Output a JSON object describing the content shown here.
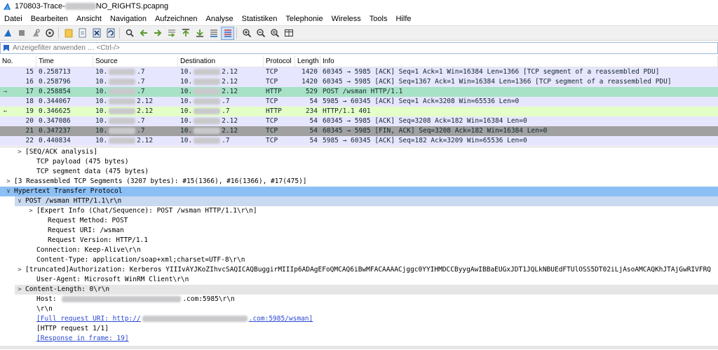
{
  "window": {
    "title_prefix": "170803-Trace-",
    "title_suffix": "NO_RIGHTS.pcapng",
    "icon": "wireshark-fin-icon"
  },
  "menu": [
    "Datei",
    "Bearbeiten",
    "Ansicht",
    "Navigation",
    "Aufzeichnen",
    "Analyse",
    "Statistiken",
    "Telephonie",
    "Wireless",
    "Tools",
    "Hilfe"
  ],
  "toolbar": {
    "buttons": [
      "start-capture-icon",
      "stop-capture-icon",
      "restart-capture-icon",
      "capture-options-icon",
      "open-file-icon",
      "save-file-icon",
      "close-file-icon",
      "reload-file-icon",
      "find-packet-icon",
      "go-back-icon",
      "go-forward-icon",
      "go-to-packet-icon",
      "go-first-icon",
      "go-last-icon",
      "autoscroll-icon",
      "colorize-icon",
      "zoom-in-icon",
      "zoom-out-icon",
      "zoom-normal-icon",
      "resize-columns-icon"
    ]
  },
  "filter": {
    "placeholder": "Anzeigefilter anwenden … <Ctrl-/>"
  },
  "packet_list": {
    "headers": [
      "No.",
      "Time",
      "Source",
      "Destination",
      "Protocol",
      "Length",
      "Info"
    ],
    "rows": [
      {
        "no": "15",
        "time": "0.258713",
        "src_a": "10.",
        "src_b": ".7",
        "dst_a": "10.",
        "dst_b": "2.12",
        "proto": "TCP",
        "len": "1420",
        "info": "60345 → 5985 [ACK] Seq=1 Ack=1 Win=16384 Len=1366 [TCP segment of a reassembled PDU]",
        "bg": "#e7e6ff",
        "fg": "#12272e",
        "gutter": ""
      },
      {
        "no": "16",
        "time": "0.258796",
        "src_a": "10.",
        "src_b": ".7",
        "dst_a": "10.",
        "dst_b": "2.12",
        "proto": "TCP",
        "len": "1420",
        "info": "60345 → 5985 [ACK] Seq=1367 Ack=1 Win=16384 Len=1366 [TCP segment of a reassembled PDU]",
        "bg": "#e7e6ff",
        "fg": "#12272e",
        "gutter": ""
      },
      {
        "no": "17",
        "time": "0.258854",
        "src_a": "10.",
        "src_b": ".7",
        "dst_a": "10.",
        "dst_b": "2.12",
        "proto": "HTTP",
        "len": "529",
        "info": "POST /wsman HTTP/1.1",
        "bg": "#a8e2c6",
        "fg": "#12272e",
        "gutter": "→"
      },
      {
        "no": "18",
        "time": "0.344067",
        "src_a": "10.",
        "src_b": "2.12",
        "dst_a": "10.",
        "dst_b": ".7",
        "proto": "TCP",
        "len": "54",
        "info": "5985 → 60345 [ACK] Seq=1 Ack=3208 Win=65536 Len=0",
        "bg": "#e7e6ff",
        "fg": "#12272e",
        "gutter": ""
      },
      {
        "no": "19",
        "time": "0.346625",
        "src_a": "10.",
        "src_b": "2.12",
        "dst_a": "10.",
        "dst_b": ".7",
        "proto": "HTTP",
        "len": "234",
        "info": "HTTP/1.1 401",
        "bg": "#e4ffc7",
        "fg": "#12272e",
        "gutter": "←"
      },
      {
        "no": "20",
        "time": "0.347086",
        "src_a": "10.",
        "src_b": ".7",
        "dst_a": "10.",
        "dst_b": "2.12",
        "proto": "TCP",
        "len": "54",
        "info": "60345 → 5985 [ACK] Seq=3208 Ack=182 Win=16384 Len=0",
        "bg": "#e7e6ff",
        "fg": "#12272e",
        "gutter": ""
      },
      {
        "no": "21",
        "time": "0.347237",
        "src_a": "10.",
        "src_b": ".7",
        "dst_a": "10.",
        "dst_b": "2.12",
        "proto": "TCP",
        "len": "54",
        "info": "60345 → 5985 [FIN, ACK] Seq=3208 Ack=182 Win=16384 Len=0",
        "bg": "#a0a0a0",
        "fg": "#12272e",
        "gutter": ""
      },
      {
        "no": "22",
        "time": "0.440834",
        "src_a": "10.",
        "src_b": "2.12",
        "dst_a": "10.",
        "dst_b": ".7",
        "proto": "TCP",
        "len": "54",
        "info": "5985 → 60345 [ACK] Seq=182 Ack=3209 Win=65536 Len=0",
        "bg": "#e7e6ff",
        "fg": "#12272e",
        "gutter": ""
      }
    ]
  },
  "details": [
    {
      "indent": 1,
      "arrow": ">",
      "text": "[SEQ/ACK analysis]",
      "style": ""
    },
    {
      "indent": 2,
      "arrow": "",
      "text": "TCP payload (475 bytes)",
      "style": ""
    },
    {
      "indent": 2,
      "arrow": "",
      "text": "TCP segment data (475 bytes)",
      "style": ""
    },
    {
      "indent": 0,
      "arrow": ">",
      "text": "[3 Reassembled TCP Segments (3207 bytes): #15(1366), #16(1366), #17(475)]",
      "style": ""
    },
    {
      "indent": 0,
      "arrow": "∨",
      "text": "Hypertext Transfer Protocol",
      "style": "section"
    },
    {
      "indent": 1,
      "arrow": "∨",
      "text": "POST /wsman HTTP/1.1\\r\\n",
      "style": "sub"
    },
    {
      "indent": 2,
      "arrow": ">",
      "text": "[Expert Info (Chat/Sequence): POST /wsman HTTP/1.1\\r\\n]",
      "style": ""
    },
    {
      "indent": 3,
      "arrow": "",
      "text": "Request Method: POST",
      "style": ""
    },
    {
      "indent": 3,
      "arrow": "",
      "text": "Request URI: /wsman",
      "style": ""
    },
    {
      "indent": 3,
      "arrow": "",
      "text": "Request Version: HTTP/1.1",
      "style": ""
    },
    {
      "indent": 2,
      "arrow": "",
      "text": "Connection: Keep-Alive\\r\\n",
      "style": ""
    },
    {
      "indent": 2,
      "arrow": "",
      "text": "Content-Type: application/soap+xml;charset=UTF-8\\r\\n",
      "style": ""
    },
    {
      "indent": 1,
      "arrow": ">",
      "text": "[truncated]Authorization: Kerberos YIIIvAYJKoZIhvcSAQICAQBuggirMIIIp6ADAgEFoQMCAQ6iBwMFACAAAACjggc0YYIHMDCCByygAwIBBaEUGxJDT1JQLkNBUEdFTUlOSS5DT02iLjAsoAMCAQKhJTAjGwRIVFRQ",
      "style": ""
    },
    {
      "indent": 2,
      "arrow": "",
      "text": "User-Agent: Microsoft WinRM Client\\r\\n",
      "style": ""
    },
    {
      "indent": 1,
      "arrow": ">",
      "text": "Content-Length: 0\\r\\n",
      "style": "gray"
    },
    {
      "indent": 2,
      "arrow": "",
      "text": "Host: ",
      "suffix": ".com:5985\\r\\n",
      "blur": true,
      "style": ""
    },
    {
      "indent": 2,
      "arrow": "",
      "text": "\\r\\n",
      "style": ""
    },
    {
      "indent": 2,
      "arrow": "",
      "text": "[Full request URI: http://",
      "suffix": ".com:5985/wsman]",
      "blur": true,
      "style": "link"
    },
    {
      "indent": 2,
      "arrow": "",
      "text": "[HTTP request 1/1]",
      "style": ""
    },
    {
      "indent": 2,
      "arrow": "",
      "text": "[Response in frame: 19]",
      "style": "link"
    }
  ]
}
